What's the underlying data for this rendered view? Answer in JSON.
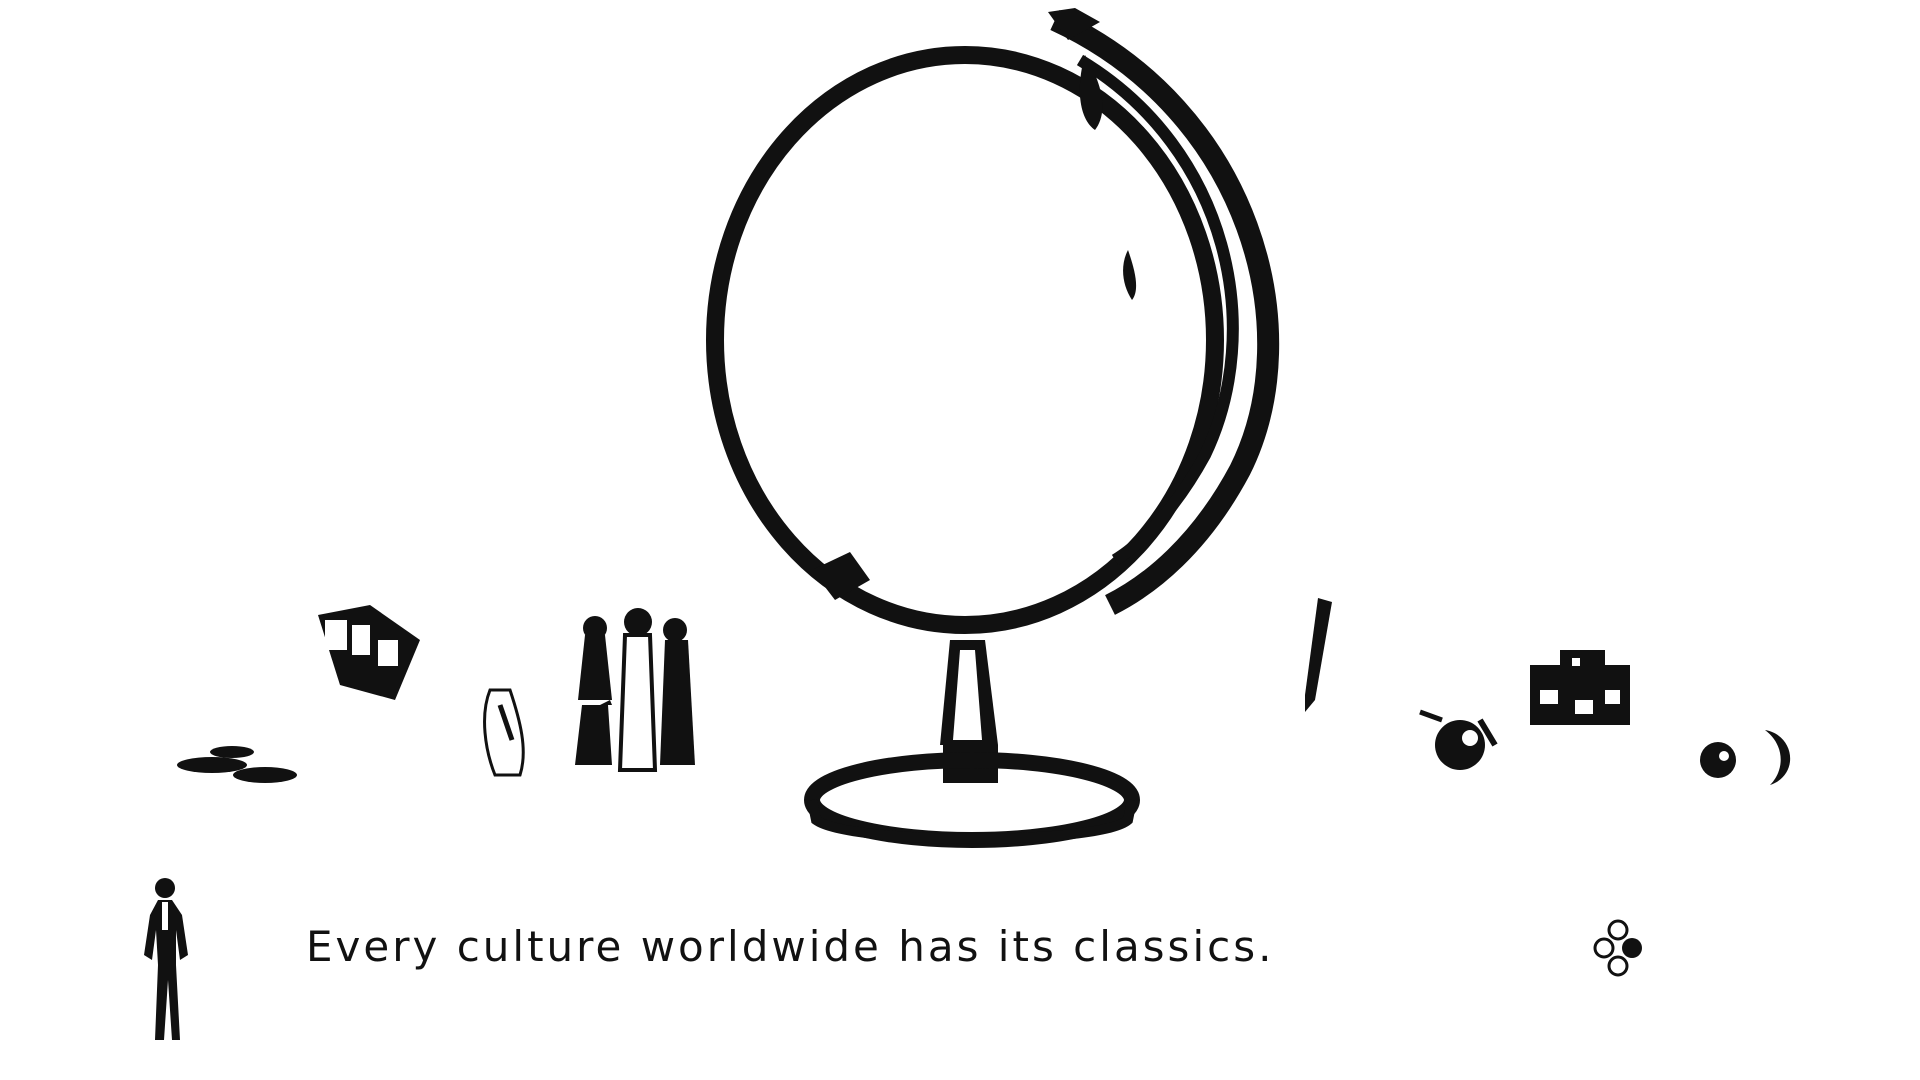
{
  "dialogue": {
    "text": "Every culture worldwide has its classics."
  },
  "icons": {
    "narrator": "standing-man-figure",
    "advance": "three-circles-advance-icon",
    "globe": "globe-icon"
  },
  "colors": {
    "ink": "#111111",
    "background": "#ffffff"
  }
}
